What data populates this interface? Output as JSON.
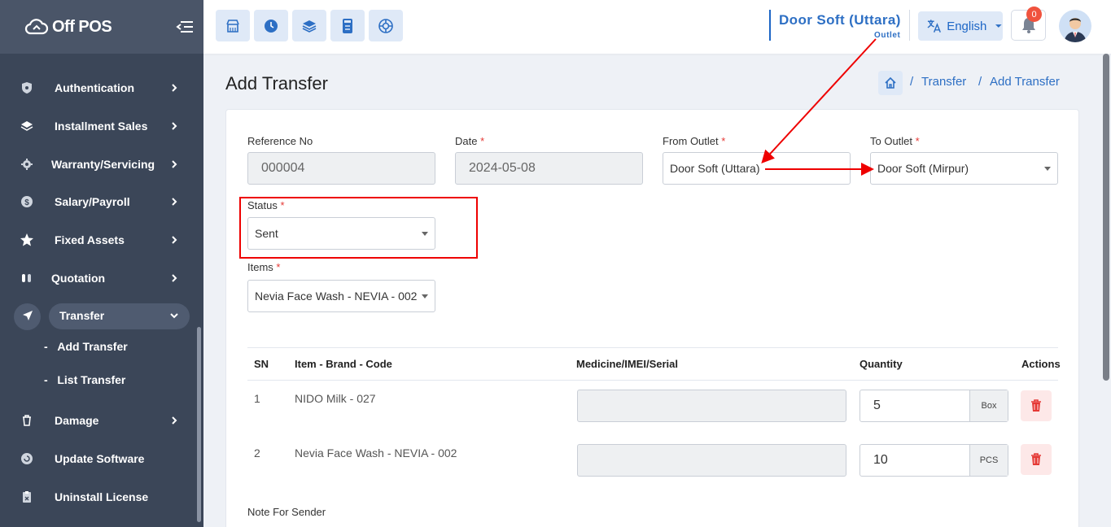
{
  "brand": {
    "name": "Off POS"
  },
  "sidebar": {
    "items": [
      {
        "label": "Authentication",
        "icon": "shield-icon"
      },
      {
        "label": "Installment Sales",
        "icon": "layers-icon"
      },
      {
        "label": "Warranty/Servicing",
        "icon": "gear-icon"
      },
      {
        "label": "Salary/Payroll",
        "icon": "dollar-icon"
      },
      {
        "label": "Fixed Assets",
        "icon": "star-icon"
      },
      {
        "label": "Quotation",
        "icon": "quotation-icon"
      },
      {
        "label": "Transfer",
        "icon": "send-icon"
      },
      {
        "label": "Damage",
        "icon": "trash-icon"
      },
      {
        "label": "Update Software",
        "icon": "refresh-icon"
      },
      {
        "label": "Uninstall License",
        "icon": "clipboard-icon"
      }
    ],
    "transfer_sub": [
      "Add Transfer",
      "List Transfer"
    ]
  },
  "topbar": {
    "outlet_name": "Door Soft (Uttara)",
    "outlet_sub": "Outlet",
    "language": "English",
    "notification_count": "0"
  },
  "page": {
    "title": "Add Transfer",
    "breadcrumb": [
      "Transfer",
      "Add Transfer"
    ]
  },
  "form": {
    "reference_label": "Reference No",
    "reference_value": "000004",
    "date_label": "Date",
    "date_value": "2024-05-08",
    "from_label": "From Outlet",
    "from_value": "Door Soft (Uttara)",
    "to_label": "To Outlet",
    "to_value": "Door Soft (Mirpur)",
    "status_label": "Status",
    "status_value": "Sent",
    "items_label": "Items",
    "items_value": "Nevia Face Wash - NEVIA - 002",
    "required_mark": "*",
    "note_label": "Note For Sender"
  },
  "table": {
    "headers": [
      "SN",
      "Item - Brand - Code",
      "Medicine/IMEI/Serial",
      "Quantity",
      "Actions"
    ],
    "rows": [
      {
        "sn": "1",
        "item": "NIDO Milk - 027",
        "qty": "5",
        "unit": "Box"
      },
      {
        "sn": "2",
        "item": "Nevia Face Wash - NEVIA - 002",
        "qty": "10",
        "unit": "PCS"
      }
    ]
  },
  "colors": {
    "accent": "#2d6fc4",
    "sidebar": "#3b4658",
    "annotation": "#e00000"
  }
}
